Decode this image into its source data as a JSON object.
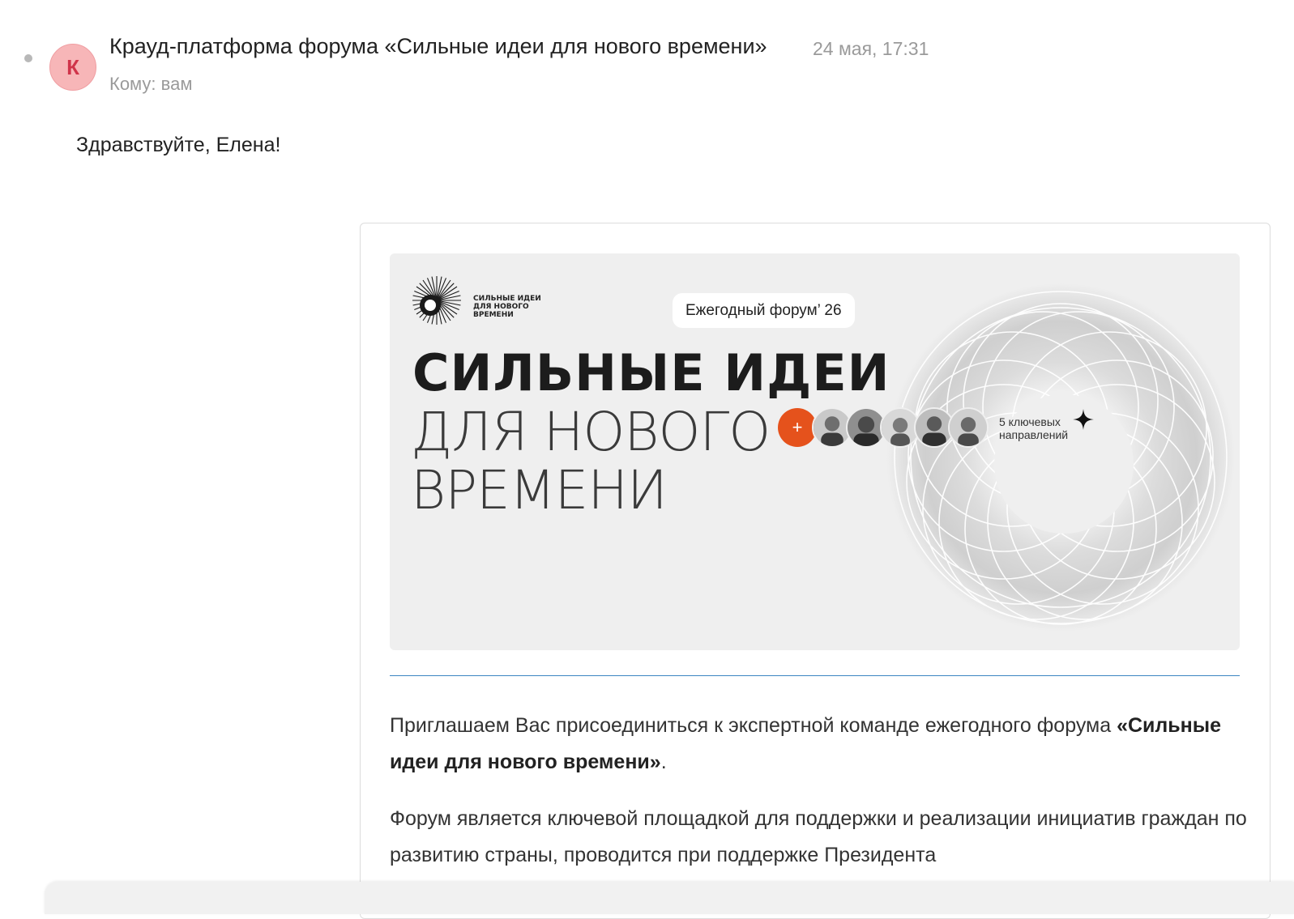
{
  "message": {
    "avatar_letter": "К",
    "avatar_color": "#f7b6b8",
    "sender": "Крауд-платформа форума «Сильные идеи для нового времени»",
    "date": "24 мая, 17:31",
    "recipient": "Кому: вам",
    "greeting": "Здравствуйте, Елена!"
  },
  "banner": {
    "logo_text": "Сильные идеи для нового времени",
    "pill": "Ежегодный форум’ 26",
    "headline_line1": "СИЛЬНЫЕ ИДЕИ",
    "headline_line2": "ДЛЯ НОВОГО",
    "headline_line3": "ВРЕМЕНИ",
    "plus": "+",
    "directions": "5 ключевых направлений",
    "accent_color": "#e5521c"
  },
  "body": {
    "para1_text": "Приглашаем Вас присоединиться к экспертной команде ежегодного форума ",
    "para1_bold": "«Сильные идеи для нового времени»",
    "para1_end": ".",
    "para2_text": "Форум является ключевой площадкой для поддержки и реализации инициатив граждан по развитию страны, проводится при поддержке Президента"
  }
}
